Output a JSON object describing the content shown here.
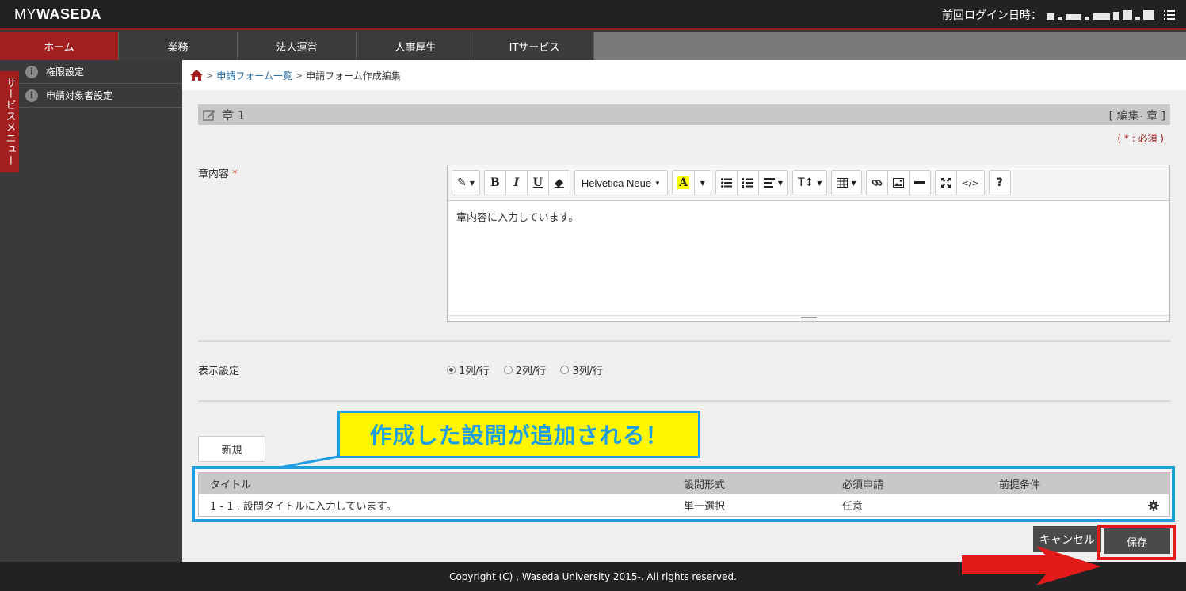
{
  "header": {
    "logo_my": "MY",
    "logo_waseda": "WASEDA",
    "last_login_label": "前回ログイン日時："
  },
  "nav": {
    "items": [
      {
        "label": "ホーム",
        "active": true
      },
      {
        "label": "業務",
        "active": false
      },
      {
        "label": "法人運営",
        "active": false
      },
      {
        "label": "人事厚生",
        "active": false
      },
      {
        "label": "ITサービス",
        "active": false
      }
    ]
  },
  "sidebar": {
    "tab_label": "サービスメニュー",
    "items": [
      {
        "label": "権限設定"
      },
      {
        "label": "申請対象者設定"
      }
    ]
  },
  "breadcrumb": {
    "sep": ">",
    "link": "申請フォーム一覧",
    "current": "申請フォーム作成編集"
  },
  "chapter": {
    "title": "章 1",
    "edit_label": "[ 編集- 章 ]",
    "required_note": "( * : 必須 )"
  },
  "content_field": {
    "label": "章内容",
    "required_mark": "*",
    "value": "章内容に入力しています。",
    "toolbar": {
      "style": "✎",
      "bold": "B",
      "italic": "I",
      "underline": "U",
      "font": "Helvetica Neue",
      "highlight": "A",
      "height": "T↕",
      "help": "?"
    }
  },
  "display_setting": {
    "label": "表示設定",
    "options": [
      {
        "label": "1列/行",
        "selected": true
      },
      {
        "label": "2列/行",
        "selected": false
      },
      {
        "label": "3列/行",
        "selected": false
      }
    ]
  },
  "new_button": "新規",
  "callout": "作成した設問が追加される！",
  "table": {
    "headers": [
      "タイトル",
      "設問形式",
      "必須申請",
      "前提条件"
    ],
    "rows": [
      {
        "title": "1 - 1 . 設問タイトルに入力しています。",
        "type": "単一選択",
        "required": "任意",
        "precondition": ""
      }
    ]
  },
  "buttons": {
    "cancel": "キャンセル",
    "save": "保存"
  },
  "footer": "Copyright (C) , Waseda University 2015-. All rights reserved.",
  "colors": {
    "brand_red": "#a21f1f",
    "callout_yellow": "#fff600",
    "callout_blue": "#1e9ee0",
    "highlight_red": "#e41a1a"
  }
}
